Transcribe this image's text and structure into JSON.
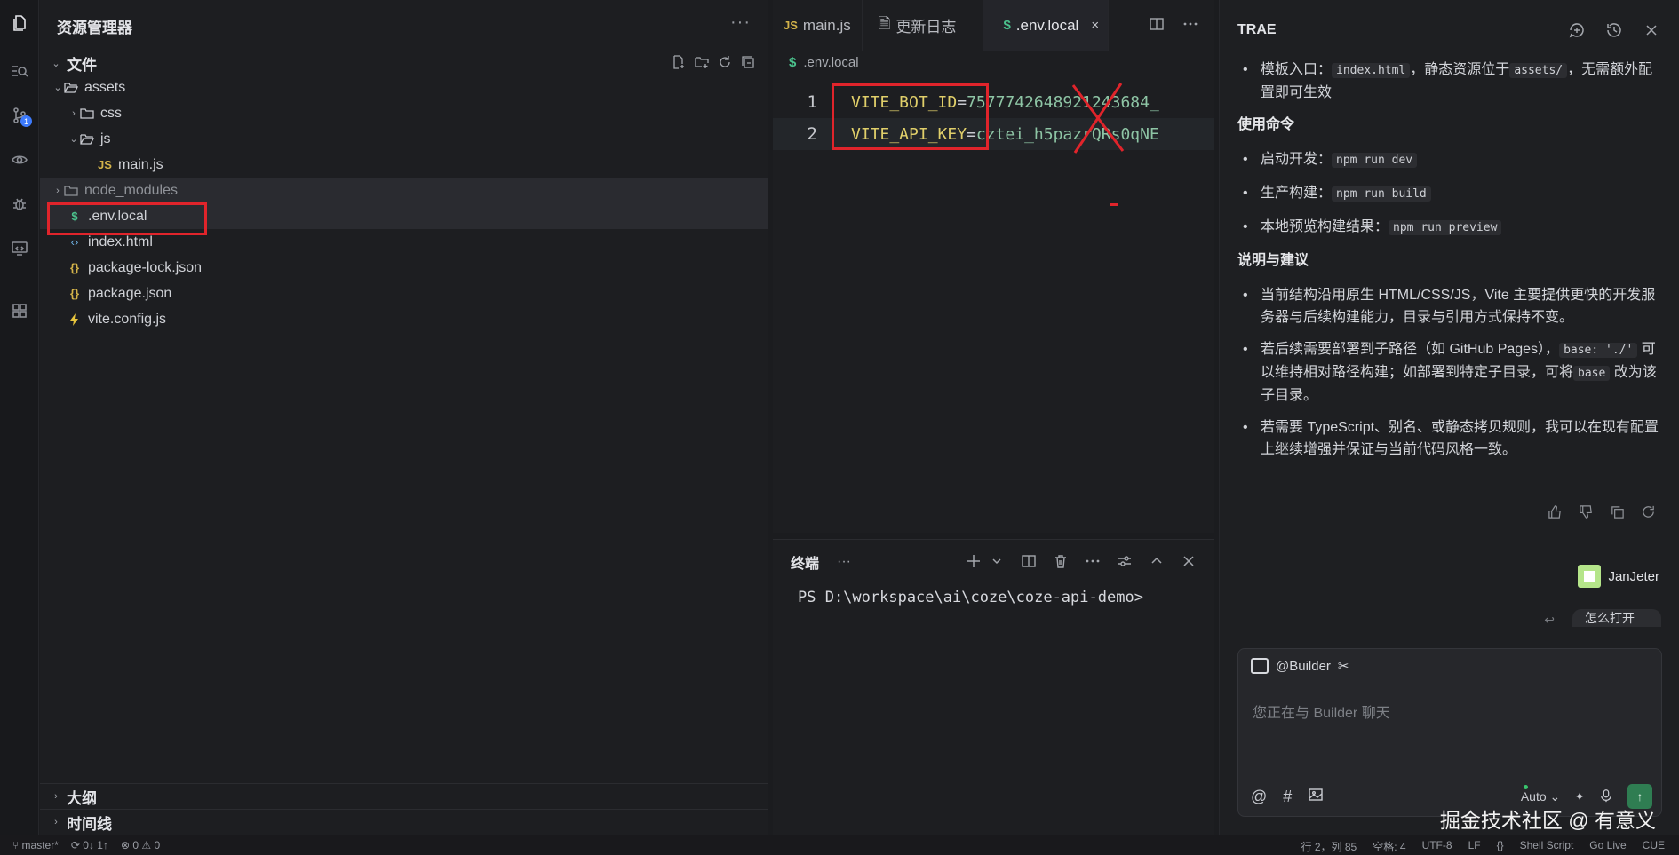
{
  "explorer": {
    "title": "资源管理器",
    "more": "···",
    "section": "文件",
    "tree": [
      {
        "label": "assets",
        "kind": "folder-open"
      },
      {
        "label": "css",
        "kind": "folder"
      },
      {
        "label": "js",
        "kind": "folder-open"
      },
      {
        "label": "main.js",
        "kind": "js"
      },
      {
        "label": "node_modules",
        "kind": "folder"
      },
      {
        "label": ".env.local",
        "kind": "env"
      },
      {
        "label": "index.html",
        "kind": "html"
      },
      {
        "label": "package-lock.json",
        "kind": "json"
      },
      {
        "label": "package.json",
        "kind": "json"
      },
      {
        "label": "vite.config.js",
        "kind": "vite"
      }
    ],
    "outline": "大纲",
    "timeline": "时间线"
  },
  "editor": {
    "tabs": [
      {
        "icon": "JS",
        "label": "main.js"
      },
      {
        "icon": "🗎",
        "label": "更新日志"
      },
      {
        "icon": "$",
        "label": ".env.local",
        "close": "×"
      }
    ],
    "breadcrumb": ".env.local",
    "lines": [
      {
        "num": "1",
        "key": "VITE_BOT_ID",
        "eq": "=",
        "value": "7577742648921243684_"
      },
      {
        "num": "2",
        "key": "VITE_API_KEY",
        "eq": "=",
        "value": "cztei_h5pazrQRs0qNE"
      }
    ]
  },
  "terminal": {
    "tab": "终端",
    "more": "···",
    "prompt": "PS D:\\workspace\\ai\\coze\\coze-api-demo>"
  },
  "chat": {
    "title": "TRAE",
    "intro_prefix": "模板入口：",
    "intro_code1": "index.html",
    "intro_mid": "，静态资源位于",
    "intro_code2": "assets/",
    "intro_suffix": "，无需额外配置即可生效",
    "usage_heading": "使用命令",
    "usage": [
      {
        "label": "启动开发：",
        "code": "npm run dev"
      },
      {
        "label": "生产构建：",
        "code": "npm run build"
      },
      {
        "label": "本地预览构建结果：",
        "code": "npm run preview"
      }
    ],
    "notes_heading": "说明与建议",
    "note1": "当前结构沿用原生 HTML/CSS/JS，Vite 主要提供更快的开发服务器与后续构建能力，目录与引用方式保持不变。",
    "note2_prefix": "若后续需要部署到子路径（如 GitHub Pages），",
    "note2_code1": "base: './'",
    "note2_mid": "可以维持相对路径构建；如部署到特定子目录，可将",
    "note2_code2": "base",
    "note2_suffix": "改为该子目录。",
    "note3": "若需要 TypeScript、别名、或静态拷贝规则，我可以在现有配置上继续增强并保证与当前代码风格一致。",
    "user_name": "JanJeter",
    "reply_preview": "怎么打开",
    "input_tag": "@Builder",
    "input_placeholder": "您正在与 Builder 聊天",
    "mode": "Auto"
  },
  "watermark": "掘金技术社区 @ 有意义",
  "status": {
    "branch": "master*",
    "sync": "0↓ 1↑",
    "errors": "0",
    "warnings": "0",
    "position": "行 2，列 85",
    "spaces": "空格: 4",
    "encoding": "UTF-8",
    "eol": "LF",
    "braces": "{}",
    "language": "Shell Script",
    "golive": "Go Live",
    "cue": "CUE"
  },
  "colors": {
    "highlight_red": "#e0242b",
    "key_yellow": "#e0cf6a",
    "value_green": "#8ec5a5",
    "accent_blue": "#3d7bfd",
    "send_green": "#2f7d52"
  }
}
